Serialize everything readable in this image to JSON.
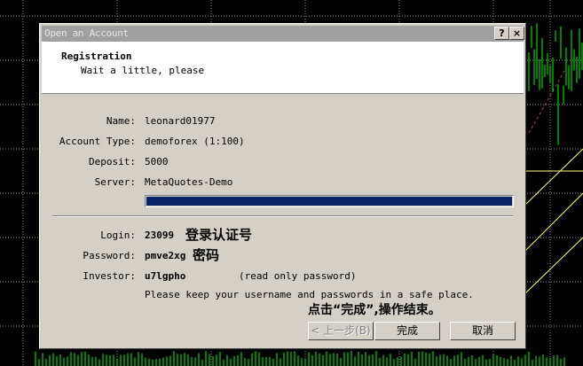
{
  "dialog": {
    "title": "Open an Account",
    "help_glyph": "?",
    "close_glyph": "×",
    "header_title": "Registration",
    "header_subtitle": "Wait a little, please"
  },
  "account": {
    "name_label": "Name:",
    "name_value": "leonard01977",
    "type_label": "Account Type:",
    "type_value": "demoforex (1:100)",
    "deposit_label": "Deposit:",
    "deposit_value": "5000",
    "server_label": "Server:",
    "server_value": "MetaQuotes-Demo",
    "progress": 1.0
  },
  "credentials": {
    "login_label": "Login:",
    "login_value": "23099",
    "login_note": "登录认证号",
    "password_label": "Password:",
    "password_value": "pmve2xg",
    "password_note": "密码",
    "investor_label": "Investor:",
    "investor_value": "u7lgpho",
    "investor_note": "(read only password)",
    "keep_note": "Please keep your username and passwords in a safe place."
  },
  "annotation": "点击“完成”,操作结束。",
  "buttons": {
    "back": "< 上一步(B)",
    "finish": "完成",
    "cancel": "取消"
  },
  "colors": {
    "chart_bg": "#000000",
    "candles": "#00ff00",
    "grid": "#c8c8c8",
    "progress_fill": "#0a246a",
    "trend_lines": "#ffff80"
  }
}
